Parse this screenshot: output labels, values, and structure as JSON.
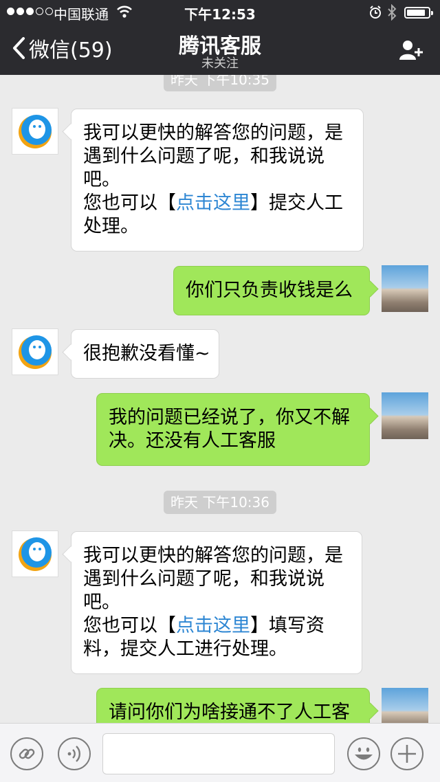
{
  "status_bar": {
    "carrier": "中国联通",
    "time": "下午12:53",
    "battery_level": 0.85
  },
  "nav": {
    "back_label": "微信(59)",
    "title": "腾讯客服",
    "subtitle": "未关注"
  },
  "messages": {
    "stamp1": "昨天 下午10:35",
    "m1": {
      "l1": "我可以更快的解答您的问题，是",
      "l2": "遇到什么问题了呢，和我说说",
      "l3": "吧。",
      "l4a": "您也可以【",
      "l4link": "点击这里",
      "l4b": "】提交人工",
      "l5": "处理。"
    },
    "m2": "你们只负责收钱是么",
    "m3": "很抱歉没看懂~",
    "m4": {
      "l1": "我的问题已经说了，你又不解",
      "l2": "决。还没有人工客服"
    },
    "stamp2": "昨天 下午10:36",
    "m5": {
      "l1": "我可以更快的解答您的问题，是",
      "l2": "遇到什么问题了呢，和我说说",
      "l3": "吧。",
      "l4a": "您也可以【",
      "l4link": "点击这里",
      "l4b": "】填写资",
      "l5": "料，提交人工进行处理。"
    },
    "m6": "请问你们为啥接通不了人工客"
  },
  "input": {
    "value": ""
  },
  "icons": {
    "back": "chevron-left-icon",
    "add_user": "add-user-icon",
    "bot_avatar": "qq-penguin-icon",
    "user_avatar": "photo-avatar",
    "link": "link-icon",
    "voice": "voice-icon",
    "emoji": "emoji-icon",
    "more": "plus-icon"
  },
  "colors": {
    "top_bar": "#2b2b2f",
    "chat_bg": "#ebebeb",
    "outgoing_bubble": "#a0e75a",
    "incoming_bubble": "#ffffff",
    "link": "#2d86d3",
    "timestamp_bg": "#cecece"
  }
}
